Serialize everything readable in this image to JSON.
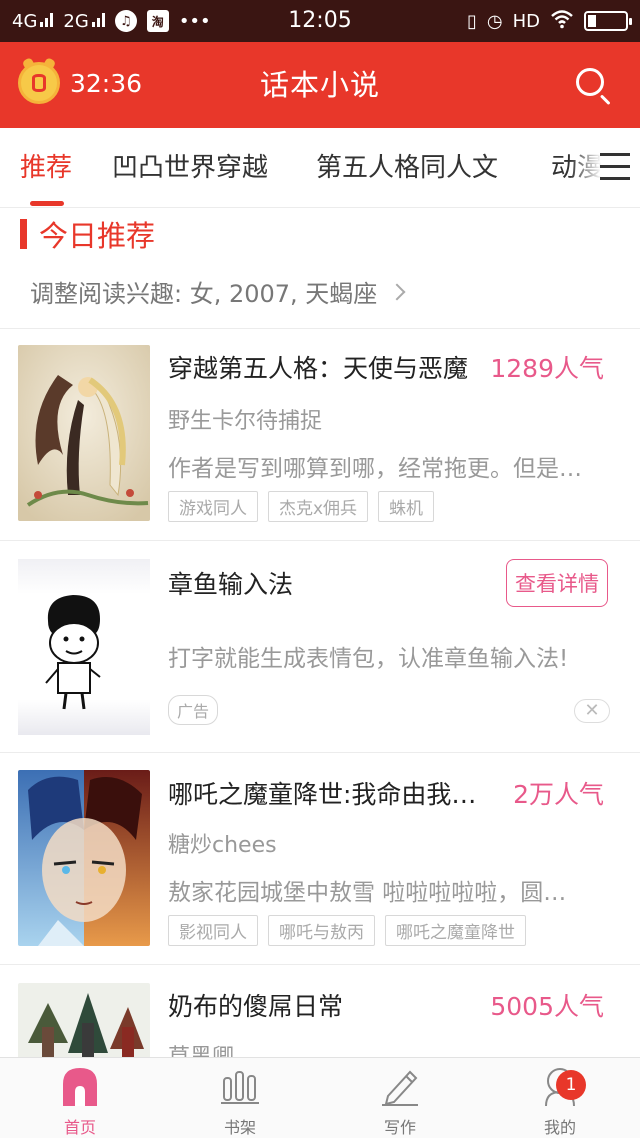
{
  "status_bar": {
    "net1": "4G",
    "net2": "2G",
    "dots": "•••",
    "time": "12:05",
    "hd": "HD"
  },
  "header": {
    "timer": "32:36",
    "title": "话本小说",
    "timer_icon": "alarm-coin-icon",
    "search_icon": "search-icon"
  },
  "tabs": [
    "推荐",
    "凹凸世界穿越",
    "第五人格同人文",
    "动漫"
  ],
  "section": {
    "title": "今日推荐",
    "preference": "调整阅读兴趣: 女, 2007, 天蝎座"
  },
  "books": [
    {
      "title": "穿越第五人格：天使与恶魔",
      "popularity": "1289人气",
      "author": "野生卡尔待捕捉",
      "description": "作者是写到哪算到哪，经常拖更。但是…",
      "tags": [
        "游戏同人",
        "杰克x佣兵",
        "蛛机"
      ]
    },
    {
      "title": "哪吒之魔童降世:我命由我…",
      "popularity": "2万人气",
      "author": "糖炒chees",
      "description": "敖家花园城堡中敖雪 啦啦啦啦啦，圆…",
      "tags": [
        "影视同人",
        "哪吒与敖丙",
        "哪吒之魔童降世"
      ]
    },
    {
      "title": "奶布的傻屌日常",
      "popularity": "5005人气",
      "author": "草黑卿"
    }
  ],
  "ad": {
    "title": "章鱼输入法",
    "button": "查看详情",
    "description": "打字就能生成表情包，认准章鱼输入法!",
    "tag": "广告",
    "close": "✕"
  },
  "bottom_nav": [
    {
      "label": "首页",
      "icon": "home-icon"
    },
    {
      "label": "书架",
      "icon": "bookshelf-icon"
    },
    {
      "label": "写作",
      "icon": "pen-icon"
    },
    {
      "label": "我的",
      "icon": "profile-icon",
      "badge": "1"
    }
  ],
  "colors": {
    "accent": "#e8372a",
    "pink": "#e8598a",
    "status_bar": "#3a1512"
  }
}
